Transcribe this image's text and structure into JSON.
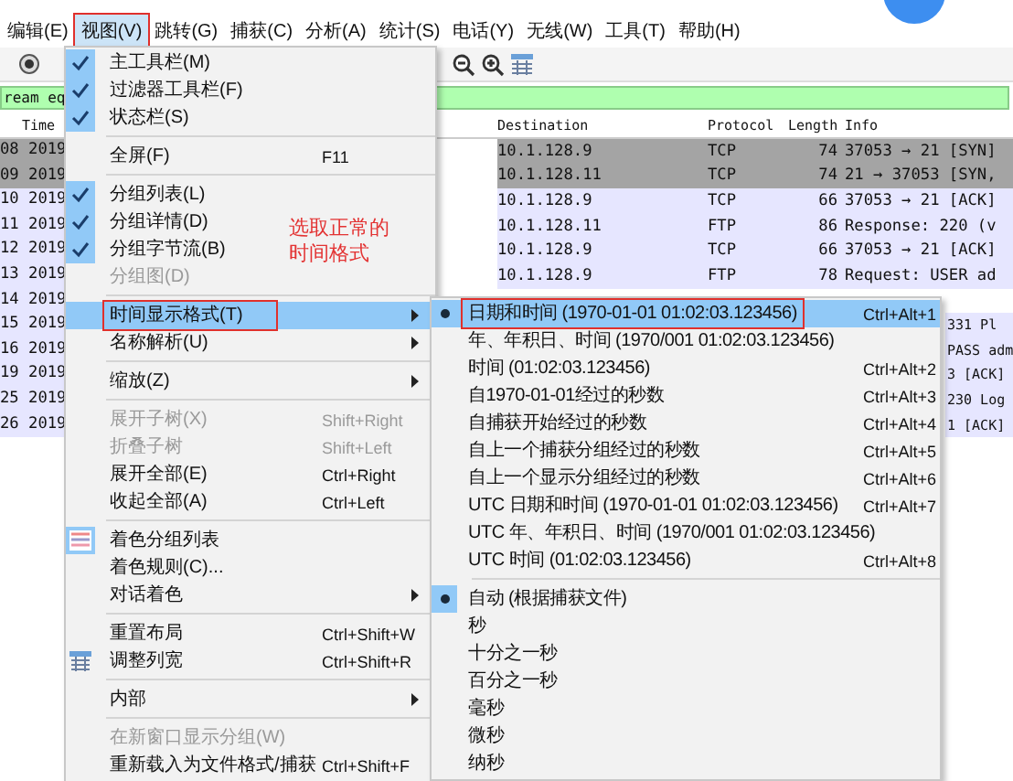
{
  "menu_bar": [
    {
      "label": "编辑(E)",
      "selected": false,
      "marked": false
    },
    {
      "label": "视图(V)",
      "selected": true,
      "marked": true
    },
    {
      "label": "跳转(G)",
      "selected": false,
      "marked": false
    },
    {
      "label": "捕获(C)",
      "selected": false,
      "marked": false
    },
    {
      "label": "分析(A)",
      "selected": false,
      "marked": false
    },
    {
      "label": "统计(S)",
      "selected": false,
      "marked": false
    },
    {
      "label": "电话(Y)",
      "selected": false,
      "marked": false
    },
    {
      "label": "无线(W)",
      "selected": false,
      "marked": false
    },
    {
      "label": "工具(T)",
      "selected": false,
      "marked": false
    },
    {
      "label": "帮助(H)",
      "selected": false,
      "marked": false
    }
  ],
  "filter": {
    "value": "ream eq"
  },
  "packet_list": {
    "columns": [
      "Time",
      "Destination",
      "Protocol",
      "Length",
      "Info"
    ],
    "rows": [
      {
        "kind": "full",
        "column_1": "08 2019",
        "destination": "10.1.128.9",
        "protocol": "TCP",
        "length": "74",
        "info": "37053 → 21 [SYN]",
        "color": "#a4a4a4"
      },
      {
        "kind": "full",
        "column_1": "09 2019",
        "destination": "10.1.128.11",
        "protocol": "TCP",
        "length": "74",
        "info": "21 → 37053 [SYN,",
        "color": "#a4a4a4"
      },
      {
        "kind": "full",
        "column_1": "10 2019",
        "destination": "10.1.128.9",
        "protocol": "TCP",
        "length": "66",
        "info": "37053 → 21 [ACK]",
        "color": "#e6e6ff"
      },
      {
        "kind": "full",
        "column_1": "11 2019",
        "destination": "10.1.128.11",
        "protocol": "FTP",
        "length": "86",
        "info": "Response: 220 (v",
        "color": "#e6e6ff"
      },
      {
        "kind": "full",
        "column_1": "12 2019",
        "destination": "10.1.128.9",
        "protocol": "TCP",
        "length": "66",
        "info": "37053 → 21 [ACK]",
        "color": "#e6e6ff"
      },
      {
        "kind": "full",
        "column_1": "13 2019",
        "destination": "10.1.128.9",
        "protocol": "FTP",
        "length": "78",
        "info": "Request: USER ad",
        "color": "#e6e6ff"
      },
      {
        "kind": "left",
        "column_1": "14 2019",
        "color": "#e6e6ff"
      },
      {
        "kind": "tail",
        "column_1": "15 2019",
        "info": "331 Pl",
        "color": "#e6e6ff"
      },
      {
        "kind": "tail",
        "column_1": "16 2019",
        "info": "PASS adm",
        "color": "#e6e6ff"
      },
      {
        "kind": "tail",
        "column_1": "19 2019",
        "info": "3 [ACK]",
        "color": "#e6e6ff"
      },
      {
        "kind": "tail",
        "column_1": "25 2019",
        "info": "230 Log",
        "color": "#e6e6ff"
      },
      {
        "kind": "tail",
        "column_1": "26 2019",
        "info": "1 [ACK]",
        "color": "#e6e6ff"
      }
    ]
  },
  "view_menu": {
    "items": [
      {
        "kind": "check",
        "label": "主工具栏(M)",
        "checked": true
      },
      {
        "kind": "check",
        "label": "过滤器工具栏(F)",
        "checked": true
      },
      {
        "kind": "check",
        "label": "状态栏(S)",
        "checked": true
      },
      {
        "kind": "separator"
      },
      {
        "kind": "plain",
        "label": "全屏(F)",
        "shortcut": "F11"
      },
      {
        "kind": "separator"
      },
      {
        "kind": "check",
        "label": "分组列表(L)",
        "checked": true
      },
      {
        "kind": "check",
        "label": "分组详情(D)",
        "checked": true
      },
      {
        "kind": "check",
        "label": "分组字节流(B)",
        "checked": true
      },
      {
        "kind": "check",
        "label": "分组图(D)",
        "checked": false,
        "disabled": true
      },
      {
        "kind": "separator"
      },
      {
        "kind": "submenu",
        "label": "时间显示格式(T)",
        "selected": true,
        "marked": true
      },
      {
        "kind": "submenu",
        "label": "名称解析(U)",
        "selected": false
      },
      {
        "kind": "separator"
      },
      {
        "kind": "submenu",
        "label": "缩放(Z)",
        "selected": false
      },
      {
        "kind": "separator"
      },
      {
        "kind": "plain",
        "label": "展开子树(X)",
        "shortcut": "Shift+Right",
        "disabled": true
      },
      {
        "kind": "plain",
        "label": "折叠子树",
        "shortcut": "Shift+Left",
        "disabled": true
      },
      {
        "kind": "plain",
        "label": "展开全部(E)",
        "shortcut": "Ctrl+Right"
      },
      {
        "kind": "plain",
        "label": "收起全部(A)",
        "shortcut": "Ctrl+Left"
      },
      {
        "kind": "separator"
      },
      {
        "kind": "stripes",
        "label": "着色分组列表",
        "checked": true
      },
      {
        "kind": "plain",
        "label": "着色规则(C)..."
      },
      {
        "kind": "submenu",
        "label": "对话着色",
        "selected": false
      },
      {
        "kind": "separator"
      },
      {
        "kind": "plain",
        "label": "重置布局",
        "shortcut": "Ctrl+Shift+W"
      },
      {
        "kind": "columns",
        "label": "调整列宽",
        "shortcut": "Ctrl+Shift+R"
      },
      {
        "kind": "separator"
      },
      {
        "kind": "submenu",
        "label": "内部",
        "selected": false
      },
      {
        "kind": "separator"
      },
      {
        "kind": "plain",
        "label": "在新窗口显示分组(W)",
        "disabled": true
      },
      {
        "kind": "plain",
        "label": "重新载入为文件格式/捕获",
        "shortcut": "Ctrl+Shift+F"
      }
    ]
  },
  "annotation": {
    "lines": [
      "选取正常的",
      "时间格式"
    ]
  },
  "time_format_menu": {
    "items": [
      {
        "kind": "radio",
        "label": "日期和时间 (1970-01-01 01:02:03.123456)",
        "shortcut": "Ctrl+Alt+1",
        "selected": true,
        "marked": true
      },
      {
        "kind": "radio",
        "label": "年、年积日、时间 (1970/001 01:02:03.123456)",
        "selected": false
      },
      {
        "kind": "radio",
        "label": "时间 (01:02:03.123456)",
        "shortcut": "Ctrl+Alt+2",
        "selected": false
      },
      {
        "kind": "radio",
        "label": "自1970-01-01经过的秒数",
        "shortcut": "Ctrl+Alt+3",
        "selected": false
      },
      {
        "kind": "radio",
        "label": "自捕获开始经过的秒数",
        "shortcut": "Ctrl+Alt+4",
        "selected": false
      },
      {
        "kind": "radio",
        "label": "自上一个捕获分组经过的秒数",
        "shortcut": "Ctrl+Alt+5",
        "selected": false
      },
      {
        "kind": "radio",
        "label": "自上一个显示分组经过的秒数",
        "shortcut": "Ctrl+Alt+6",
        "selected": false
      },
      {
        "kind": "radio",
        "label": "UTC 日期和时间 (1970-01-01 01:02:03.123456)",
        "shortcut": "Ctrl+Alt+7",
        "selected": false
      },
      {
        "kind": "radio",
        "label": "UTC 年、年积日、时间 (1970/001 01:02:03.123456)",
        "selected": false
      },
      {
        "kind": "radio",
        "label": "UTC 时间 (01:02:03.123456)",
        "shortcut": "Ctrl+Alt+8",
        "selected": false
      },
      {
        "kind": "separator"
      },
      {
        "kind": "radio",
        "label": "自动 (根据捕获文件)",
        "selected": true
      },
      {
        "kind": "radio",
        "label": "秒",
        "selected": false
      },
      {
        "kind": "radio",
        "label": "十分之一秒",
        "selected": false
      },
      {
        "kind": "radio",
        "label": "百分之一秒",
        "selected": false
      },
      {
        "kind": "radio",
        "label": "毫秒",
        "selected": false
      },
      {
        "kind": "radio",
        "label": "微秒",
        "selected": false
      },
      {
        "kind": "radio",
        "label": "纳秒",
        "selected": false
      }
    ]
  }
}
